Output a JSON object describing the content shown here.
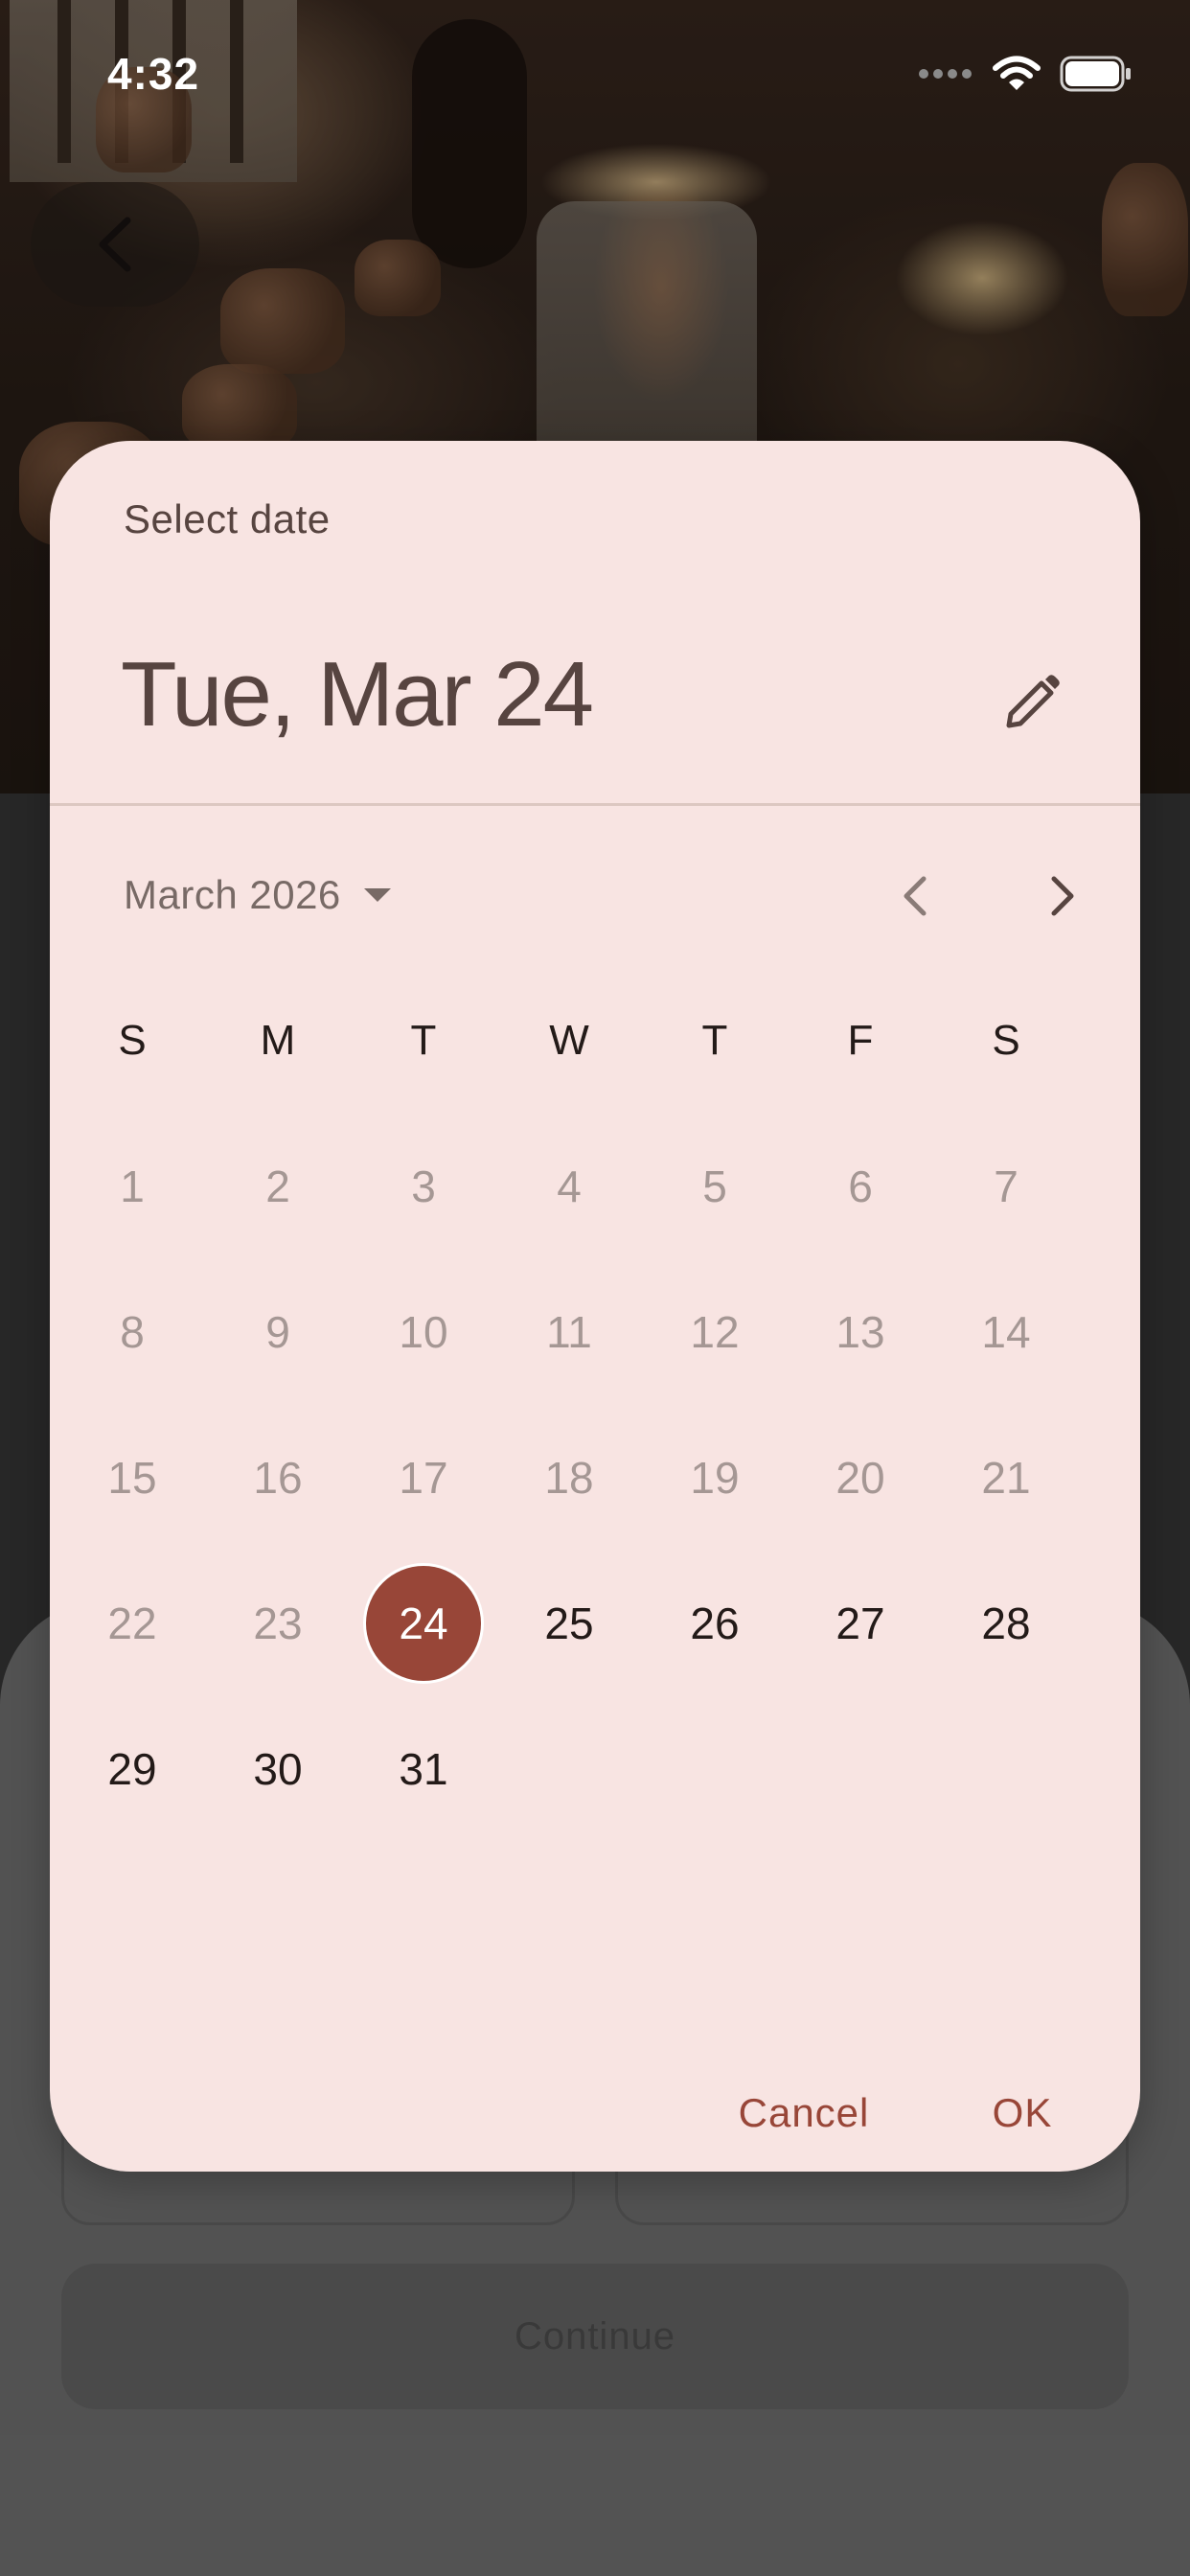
{
  "status_bar": {
    "time": "4:32",
    "icons": [
      "signal-dots-icon",
      "wifi-icon",
      "battery-icon"
    ]
  },
  "background": {
    "back_icon": "chevron-left-icon",
    "continue_label": "Continue"
  },
  "date_picker": {
    "heading": "Select date",
    "selected_date": "Tue, Mar 24",
    "edit_icon": "pencil-icon",
    "month_label": "March 2026",
    "month_dropdown_icon": "caret-down-icon",
    "prev_icon": "chevron-left-icon",
    "next_icon": "chevron-right-icon",
    "weekdays": [
      "S",
      "M",
      "T",
      "W",
      "T",
      "F",
      "S"
    ],
    "weeks": [
      [
        "1",
        "2",
        "3",
        "4",
        "5",
        "6",
        "7"
      ],
      [
        "8",
        "9",
        "10",
        "11",
        "12",
        "13",
        "14"
      ],
      [
        "15",
        "16",
        "17",
        "18",
        "19",
        "20",
        "21"
      ],
      [
        "22",
        "23",
        "24",
        "25",
        "26",
        "27",
        "28"
      ],
      [
        "29",
        "30",
        "31"
      ]
    ],
    "selected_day": "24",
    "cancel_label": "Cancel",
    "ok_label": "OK"
  },
  "colors": {
    "dialog_bg": "#f8e4e2",
    "accent": "#984638",
    "text_primary": "#231a18",
    "text_disabled": "#a59794"
  }
}
